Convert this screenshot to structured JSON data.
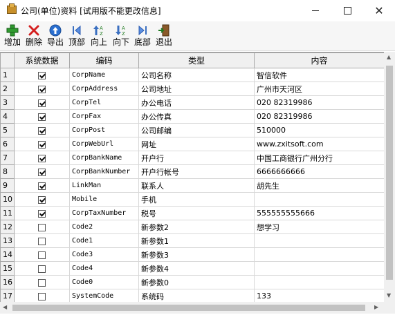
{
  "window": {
    "title": "公司(单位)资料 [试用版不能更改信息]"
  },
  "toolbar": {
    "add": "增加",
    "delete": "删除",
    "export": "导出",
    "top": "顶部",
    "up": "向上",
    "down": "向下",
    "bottom": "底部",
    "exit": "退出"
  },
  "columns": [
    "系统数据",
    "编码",
    "类型",
    "内容"
  ],
  "rows": [
    {
      "n": "1",
      "sys": true,
      "code": "CorpName",
      "type": "公司名称",
      "value": "智信软件"
    },
    {
      "n": "2",
      "sys": true,
      "code": "CorpAddress",
      "type": "公司地址",
      "value": "广州市天河区"
    },
    {
      "n": "3",
      "sys": true,
      "code": "CorpTel",
      "type": "办公电话",
      "value": "020 82319986"
    },
    {
      "n": "4",
      "sys": true,
      "code": "CorpFax",
      "type": "办公传真",
      "value": "020 82319986"
    },
    {
      "n": "5",
      "sys": true,
      "code": "CorpPost",
      "type": "公司邮编",
      "value": "510000"
    },
    {
      "n": "6",
      "sys": true,
      "code": "CorpWebUrl",
      "type": "网址",
      "value": "www.zxitsoft.com"
    },
    {
      "n": "7",
      "sys": true,
      "code": "CorpBankName",
      "type": "开户行",
      "value": "中国工商银行广州分行"
    },
    {
      "n": "8",
      "sys": true,
      "code": "CorpBankNumber",
      "type": "开户行帐号",
      "value": "6666666666"
    },
    {
      "n": "9",
      "sys": true,
      "code": "LinkMan",
      "type": "联系人",
      "value": "胡先生"
    },
    {
      "n": "10",
      "sys": true,
      "code": "Mobile",
      "type": "手机",
      "value": ""
    },
    {
      "n": "11",
      "sys": true,
      "code": "CorpTaxNumber",
      "type": "税号",
      "value": "555555555666"
    },
    {
      "n": "12",
      "sys": false,
      "code": "Code2",
      "type": "新参数2",
      "value": "想学习"
    },
    {
      "n": "13",
      "sys": false,
      "code": "Code1",
      "type": "新参数1",
      "value": ""
    },
    {
      "n": "14",
      "sys": false,
      "code": "Code3",
      "type": "新参数3",
      "value": ""
    },
    {
      "n": "15",
      "sys": false,
      "code": "Code4",
      "type": "新参数4",
      "value": ""
    },
    {
      "n": "16",
      "sys": false,
      "code": "Code0",
      "type": "新参数0",
      "value": ""
    },
    {
      "n": "17",
      "sys": false,
      "code": "SystemCode",
      "type": "系统码",
      "value": "133"
    }
  ]
}
